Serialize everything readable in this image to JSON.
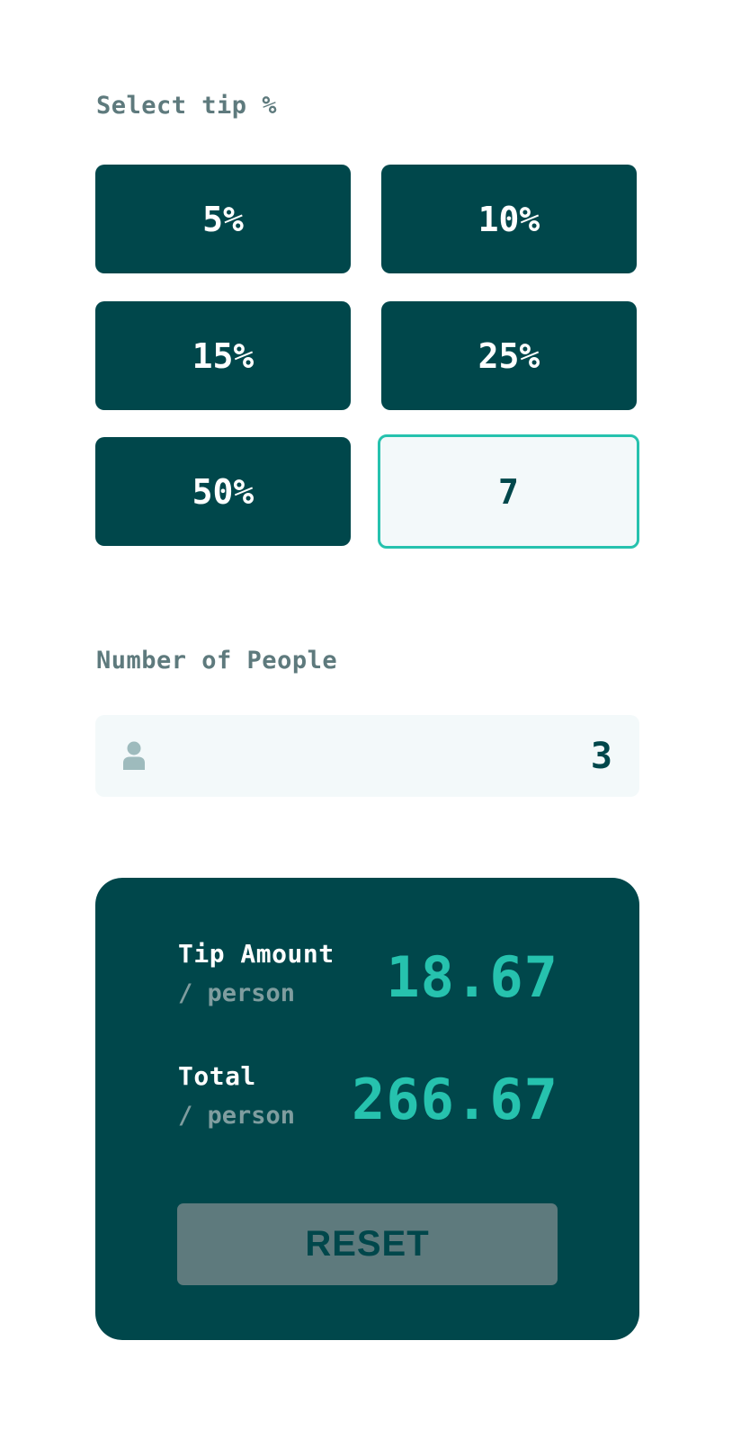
{
  "tip_section": {
    "label": "Select tip %",
    "options": [
      "5%",
      "10%",
      "15%",
      "25%",
      "50%"
    ],
    "custom_value": "7"
  },
  "people_section": {
    "label": "Number of People",
    "icon": "person-icon",
    "value": "3"
  },
  "results": {
    "tip_amount_title": "Tip Amount",
    "tip_amount_sub": "/ person",
    "tip_amount_value": "18.67",
    "total_title": "Total",
    "total_sub": "/ person",
    "total_value": "266.67",
    "reset_label": "RESET"
  },
  "colors": {
    "dark_teal": "#00474b",
    "accent": "#26c2ae",
    "grey": "#5e7a7d",
    "field_bg": "#f3f9fa"
  }
}
